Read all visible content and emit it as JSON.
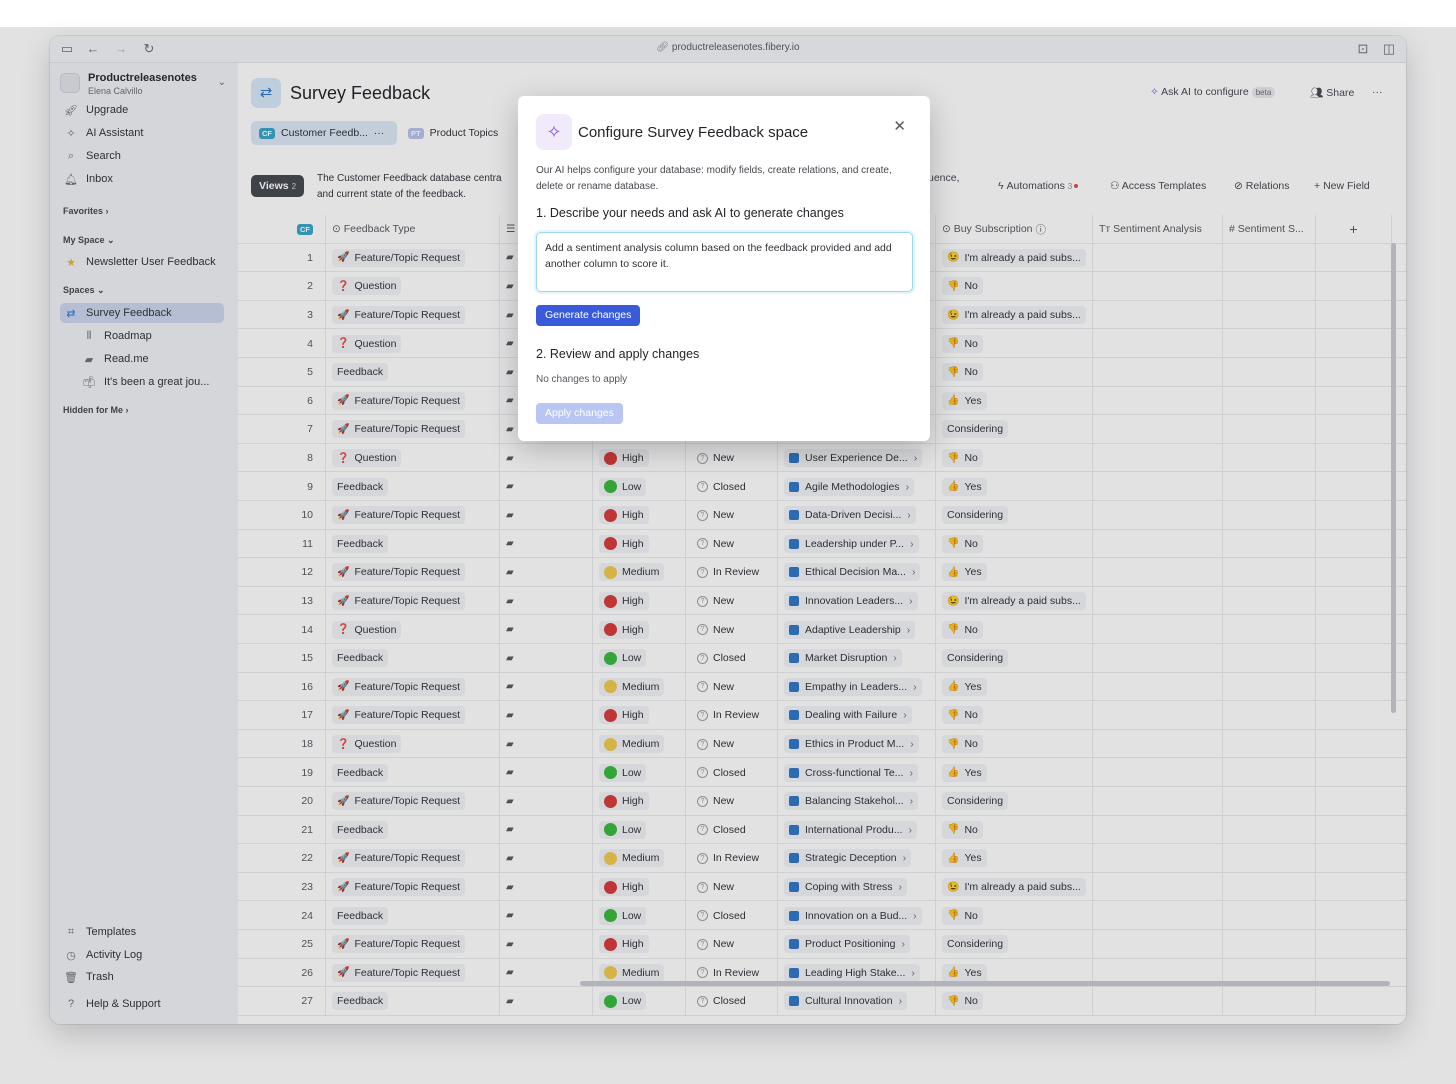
{
  "browser": {
    "url": "productreleasenotes.fibery.io"
  },
  "sidebar": {
    "workspace": {
      "name": "Productreleasenotes",
      "user": "Elena Calvillo"
    },
    "top_items": [
      {
        "label": "Upgrade",
        "icon": "rocket-icon"
      },
      {
        "label": "AI Assistant",
        "icon": "sparkle-icon"
      },
      {
        "label": "Search",
        "icon": "search-icon"
      },
      {
        "label": "Inbox",
        "icon": "bell-icon"
      }
    ],
    "favorites_label": "Favorites",
    "my_space_label": "My Space",
    "my_space_items": [
      {
        "label": "Newsletter User Feedback",
        "icon": "star-icon"
      }
    ],
    "spaces_label": "Spaces",
    "spaces": [
      {
        "label": "Survey Feedback",
        "active": true
      },
      {
        "label": "Roadmap"
      },
      {
        "label": "Read.me"
      },
      {
        "label": "It's been a great jou..."
      }
    ],
    "hidden_label": "Hidden for Me",
    "bottom_items": [
      {
        "label": "Templates",
        "icon": "templates-icon"
      },
      {
        "label": "Activity Log",
        "icon": "clock-icon"
      },
      {
        "label": "Trash",
        "icon": "trash-icon"
      },
      {
        "label": "Help & Support",
        "icon": "help-icon"
      }
    ]
  },
  "header": {
    "title": "Survey Feedback",
    "ask_ai": "Ask AI to configure",
    "beta": "beta",
    "share": "Share",
    "more": "···"
  },
  "tabs": [
    {
      "badge": "CF",
      "label": "Customer Feedb...",
      "more": "···",
      "active": true
    },
    {
      "badge": "PT",
      "label": "Product Topics",
      "active": false
    }
  ],
  "views": {
    "label": "Views",
    "count": "2"
  },
  "description": "The Customer Feedback database centra and current state of the feedback.",
  "description_tail": "uence,",
  "toolbar": {
    "automations": "Automations",
    "automations_count": "3",
    "access_templates": "Access Templates",
    "relations": "Relations",
    "new_field": "New Field"
  },
  "table": {
    "header_badge": "CF",
    "columns": [
      "Feedback Type",
      "Buy Subscription",
      "Sentiment Analysis",
      "Sentiment S...",
      "+"
    ],
    "rows": [
      [
        "1",
        "Feature/Topic Request",
        "",
        "",
        "",
        "",
        "I'm already a paid subs..."
      ],
      [
        "2",
        "Question",
        "",
        "",
        "",
        "",
        "No"
      ],
      [
        "3",
        "Feature/Topic Request",
        "",
        "",
        "",
        "",
        "I'm already a paid subs..."
      ],
      [
        "4",
        "Question",
        "",
        "",
        "",
        "",
        "No"
      ],
      [
        "5",
        "Feedback",
        "",
        "",
        "",
        "",
        "No"
      ],
      [
        "6",
        "Feature/Topic Request",
        "",
        "",
        "",
        "",
        "Yes"
      ],
      [
        "7",
        "Feature/Topic Request",
        "",
        "",
        "",
        "",
        "Considering"
      ],
      [
        "8",
        "Question",
        "High",
        "New",
        "User Experience De...",
        "",
        "No"
      ],
      [
        "9",
        "Feedback",
        "Low",
        "Closed",
        "Agile Methodologies",
        "",
        "Yes"
      ],
      [
        "10",
        "Feature/Topic Request",
        "High",
        "New",
        "Data-Driven Decisi...",
        "",
        "Considering"
      ],
      [
        "11",
        "Feedback",
        "High",
        "New",
        "Leadership under P...",
        "",
        "No"
      ],
      [
        "12",
        "Feature/Topic Request",
        "Medium",
        "In Review",
        "Ethical Decision Ma...",
        "",
        "Yes"
      ],
      [
        "13",
        "Feature/Topic Request",
        "High",
        "New",
        "Innovation Leaders...",
        "",
        "I'm already a paid subs..."
      ],
      [
        "14",
        "Question",
        "High",
        "New",
        "Adaptive Leadership",
        "",
        "No"
      ],
      [
        "15",
        "Feedback",
        "Low",
        "Closed",
        "Market Disruption",
        "",
        "Considering"
      ],
      [
        "16",
        "Feature/Topic Request",
        "Medium",
        "New",
        "Empathy in Leaders...",
        "",
        "Yes"
      ],
      [
        "17",
        "Feature/Topic Request",
        "High",
        "In Review",
        "Dealing with Failure",
        "",
        "No"
      ],
      [
        "18",
        "Question",
        "Medium",
        "New",
        "Ethics in Product M...",
        "",
        "No"
      ],
      [
        "19",
        "Feedback",
        "Low",
        "Closed",
        "Cross-functional Te...",
        "",
        "Yes"
      ],
      [
        "20",
        "Feature/Topic Request",
        "High",
        "New",
        "Balancing Stakehol...",
        "",
        "Considering"
      ],
      [
        "21",
        "Feedback",
        "Low",
        "Closed",
        "International Produ...",
        "",
        "No"
      ],
      [
        "22",
        "Feature/Topic Request",
        "Medium",
        "In Review",
        "Strategic Deception",
        "",
        "Yes"
      ],
      [
        "23",
        "Feature/Topic Request",
        "High",
        "New",
        "Coping with Stress",
        "",
        "I'm already a paid subs..."
      ],
      [
        "24",
        "Feedback",
        "Low",
        "Closed",
        "Innovation on a Bud...",
        "",
        "No"
      ],
      [
        "25",
        "Feature/Topic Request",
        "High",
        "New",
        "Product Positioning",
        "",
        "Considering"
      ],
      [
        "26",
        "Feature/Topic Request",
        "Medium",
        "In Review",
        "Leading High Stake...",
        "",
        "Yes"
      ],
      [
        "27",
        "Feedback",
        "Low",
        "Closed",
        "Cultural Innovation",
        "",
        "No"
      ]
    ]
  },
  "modal": {
    "title": "Configure Survey Feedback space",
    "description": "Our AI helps configure your database: modify fields, create relations, and create, delete or rename database.",
    "step1": "1. Describe your needs and ask AI to generate changes",
    "prompt": "Add a sentiment analysis column based on the feedback provided and add another column to score it.",
    "generate": "Generate changes",
    "step2": "2. Review and apply changes",
    "no_changes": "No changes to apply",
    "apply": "Apply changes"
  },
  "colors": {
    "accent": "#3a5bd9",
    "high": "#d73a3a",
    "low": "#35b83b",
    "medium": "#f2c94c"
  }
}
